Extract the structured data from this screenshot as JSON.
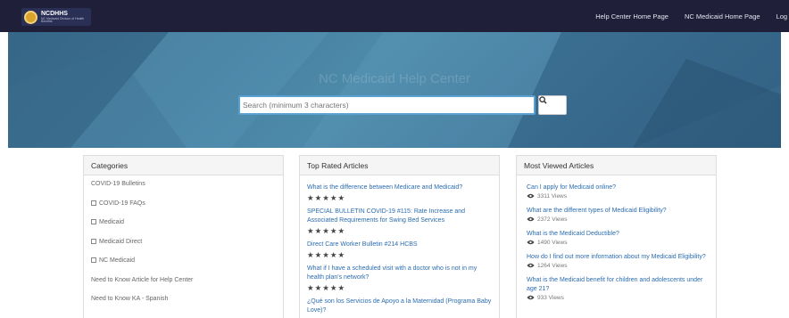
{
  "header": {
    "logo": {
      "name": "NCDHHS",
      "subtitle": "NC Medicaid Division of Health Benefits"
    },
    "nav": [
      "Help Center Home Page",
      "NC Medicaid Home Page",
      "Log in"
    ]
  },
  "hero": {
    "title": "NC Medicaid Help Center",
    "search": {
      "placeholder": "Search (minimum 3 characters)",
      "icon": "search-icon"
    }
  },
  "categories": {
    "title": "Categories",
    "items": [
      {
        "label": "COVID-19 Bulletins",
        "expandable": false
      },
      {
        "label": "COVID-19 FAQs",
        "expandable": true
      },
      {
        "label": "Medicaid",
        "expandable": true
      },
      {
        "label": "Medicaid Direct",
        "expandable": true
      },
      {
        "label": "NC Medicaid",
        "expandable": true
      },
      {
        "label": "Need to Know Article for Help Center",
        "expandable": false
      },
      {
        "label": "Need to Know KA - Spanish",
        "expandable": false
      }
    ]
  },
  "top_rated": {
    "title": "Top Rated Articles",
    "rating": "★★★★★",
    "items": [
      {
        "title": "What is the difference between Medicare and Medicaid?"
      },
      {
        "title": "SPECIAL BULLETIN COVID-19 #115: Rate Increase and Associated Requirements for Swing Bed Services"
      },
      {
        "title": "Direct Care Worker Bulletin #214 HCBS"
      },
      {
        "title": "What if I have a scheduled visit with a doctor who is not in my health plan's network?"
      },
      {
        "title": "¿Qué son los Servicios de Apoyo a la Maternidad (Programa Baby Love)?"
      }
    ]
  },
  "most_viewed": {
    "title": "Most Viewed Articles",
    "items": [
      {
        "title": "Can I apply for Medicaid online?",
        "views": "3311 Views"
      },
      {
        "title": "What are the different types of Medicaid Eligibility?",
        "views": "2372 Views"
      },
      {
        "title": "What is the Medicaid Deductible?",
        "views": "1490 Views"
      },
      {
        "title": "How do I find out more information about my Medicaid Eligibility?",
        "views": "1264 Views"
      },
      {
        "title": "What is the Medicaid benefit for children and adolescents under age 21?",
        "views": "933 Views"
      }
    ]
  }
}
